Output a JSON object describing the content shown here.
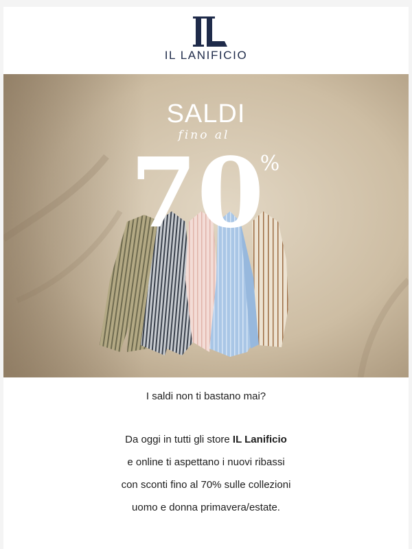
{
  "brand": {
    "monogram": "IL",
    "name": "IL LANIFICIO",
    "color": "#1f2b4a"
  },
  "hero": {
    "headline": "SALDI",
    "script_line": "fino al",
    "percent_number": "70",
    "percent_sign": "%"
  },
  "copy": {
    "intro": "I saldi non ti bastano mai?",
    "line1_prefix": "Da oggi in tutti gli store ",
    "line1_brand": "IL Lanificio",
    "line2": "e online ti aspettano i nuovi ribassi",
    "line3": "con sconti fino al 70% sulle collezioni",
    "line4": "uomo e donna primavera/estate."
  }
}
